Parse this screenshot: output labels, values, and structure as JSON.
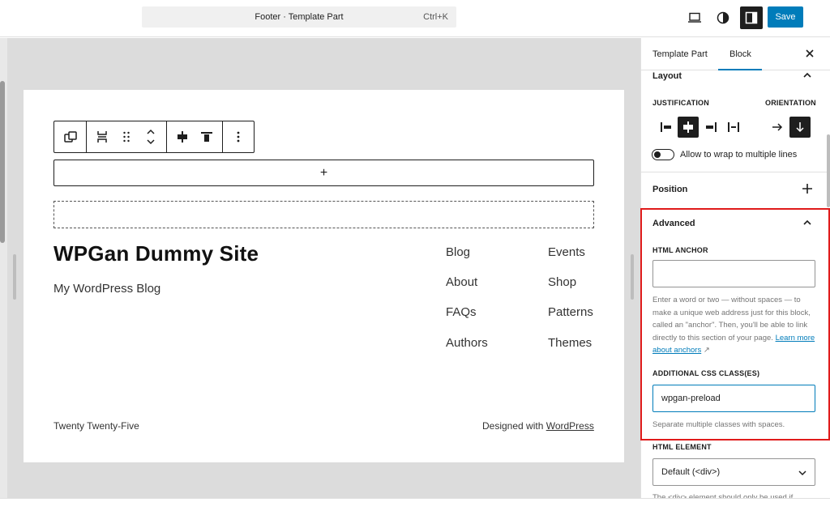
{
  "topbar": {
    "document_title": "Footer · Template Part",
    "shortcut": "Ctrl+K",
    "save_label": "Save",
    "icons": [
      "desktop-preview-icon",
      "contrast-icon",
      "sidebar-toggle-icon"
    ]
  },
  "canvas": {
    "site_title": "WPGan Dummy Site",
    "tagline": "My WordPress Blog",
    "appender_label": "+",
    "nav_col1": [
      "Blog",
      "About",
      "FAQs",
      "Authors"
    ],
    "nav_col2": [
      "Events",
      "Shop",
      "Patterns",
      "Themes"
    ],
    "footer_left": "Twenty Twenty-Five",
    "footer_right_prefix": "Designed with ",
    "footer_right_link": "WordPress"
  },
  "sidebar": {
    "tabs": [
      "Template Part",
      "Block"
    ],
    "active_tab": "Block",
    "layout": {
      "title": "Layout",
      "justification_label": "JUSTIFICATION",
      "orientation_label": "ORIENTATION",
      "justification_active": "center",
      "orientation_active": "vertical",
      "wrap_label": "Allow to wrap to multiple lines",
      "wrap_on": false
    },
    "position": {
      "title": "Position"
    },
    "advanced": {
      "title": "Advanced",
      "anchor_label": "HTML ANCHOR",
      "anchor_value": "",
      "anchor_help": "Enter a word or two — without spaces — to make a unique web address just for this block, called an \"anchor\". Then, you'll be able to link directly to this section of your page.",
      "anchor_help_link": "Learn more about anchors",
      "css_label": "ADDITIONAL CSS CLASS(ES)",
      "css_value": "wpgan-preload",
      "css_help": "Separate multiple classes with spaces.",
      "element_label": "HTML ELEMENT",
      "element_value": "Default (<div>)",
      "element_help": "The <div> element should only be used if"
    }
  },
  "colors": {
    "accent": "#007cba",
    "highlight": "#e01b1b",
    "dark": "#1e1e1e"
  }
}
